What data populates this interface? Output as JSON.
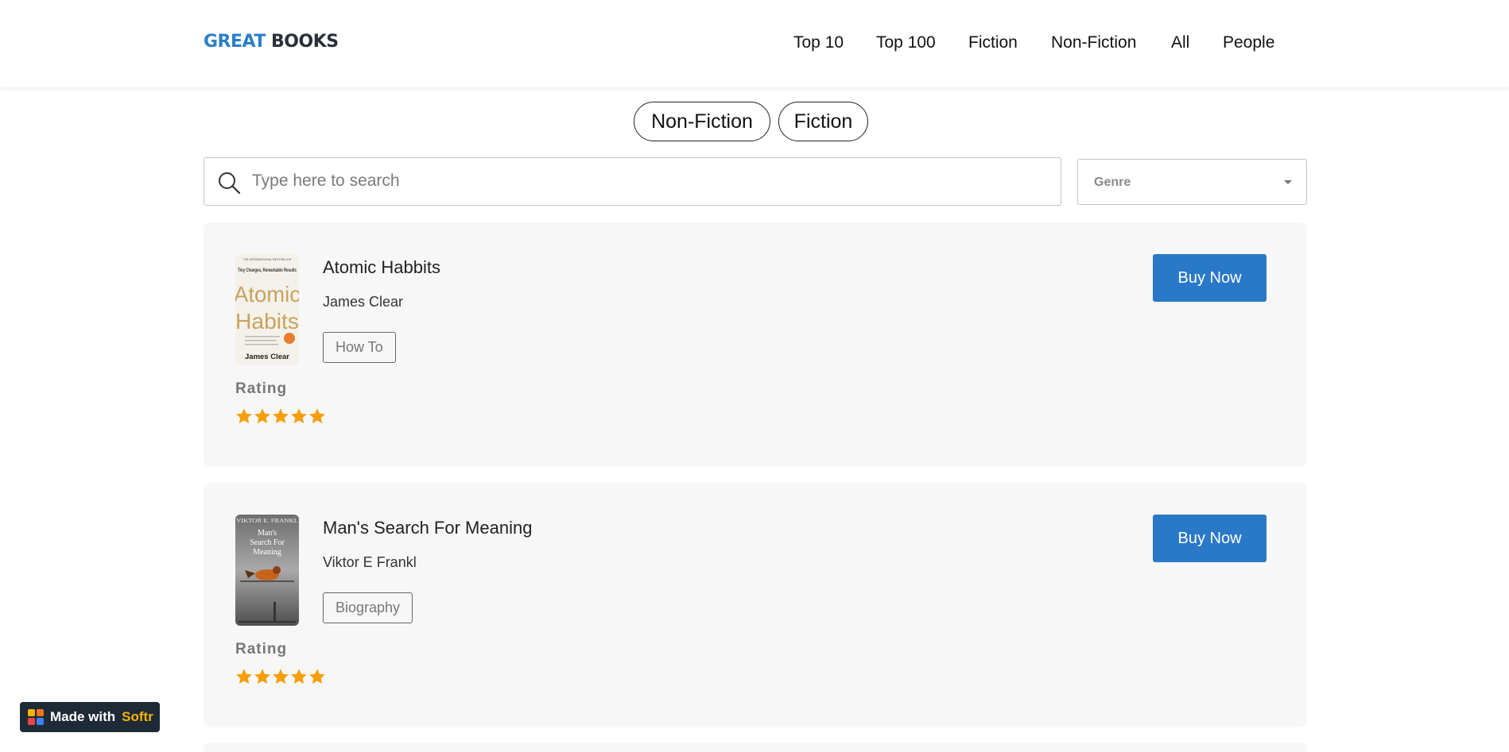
{
  "header": {
    "logo_part1": "GREAT",
    "logo_part2": "BOOKS",
    "nav": [
      "Top 10",
      "Top 100",
      "Fiction",
      "Non-Fiction",
      "All",
      "People"
    ]
  },
  "filters": {
    "pills": [
      "Non-Fiction",
      "Fiction"
    ],
    "search_placeholder": "Type here to search",
    "genre_label": "Genre"
  },
  "books": [
    {
      "title": "Atomic Habbits",
      "author": "James Clear",
      "genre_tag": "How To",
      "rating_label": "Rating",
      "rating": 5,
      "rating_max": 5,
      "buy_label": "Buy Now",
      "cover": {
        "top_line": "THE INTERNATIONAL BESTSELLER",
        "subtitle": "Tiny Changes, Remarkable Results",
        "title_line1": "Atomic",
        "title_line2": "Habits",
        "author": "James Clear"
      }
    },
    {
      "title": "Man's Search For Meaning",
      "author": "Viktor E Frankl",
      "genre_tag": "Biography",
      "rating_label": "Rating",
      "rating": 5,
      "rating_max": 5,
      "buy_label": "Buy Now",
      "cover": {
        "author": "VIKTOR E. FRANKL",
        "title_line1": "Man's",
        "title_line2": "Search For",
        "title_line3": "Meaning"
      }
    }
  ],
  "footer_badge": {
    "text": "Made with",
    "brand": "Softr"
  },
  "colors": {
    "accent": "#2a78c8",
    "logo_blue": "#2d7fc7",
    "star": "#f59e0b",
    "card_bg": "#f7f7f7"
  }
}
